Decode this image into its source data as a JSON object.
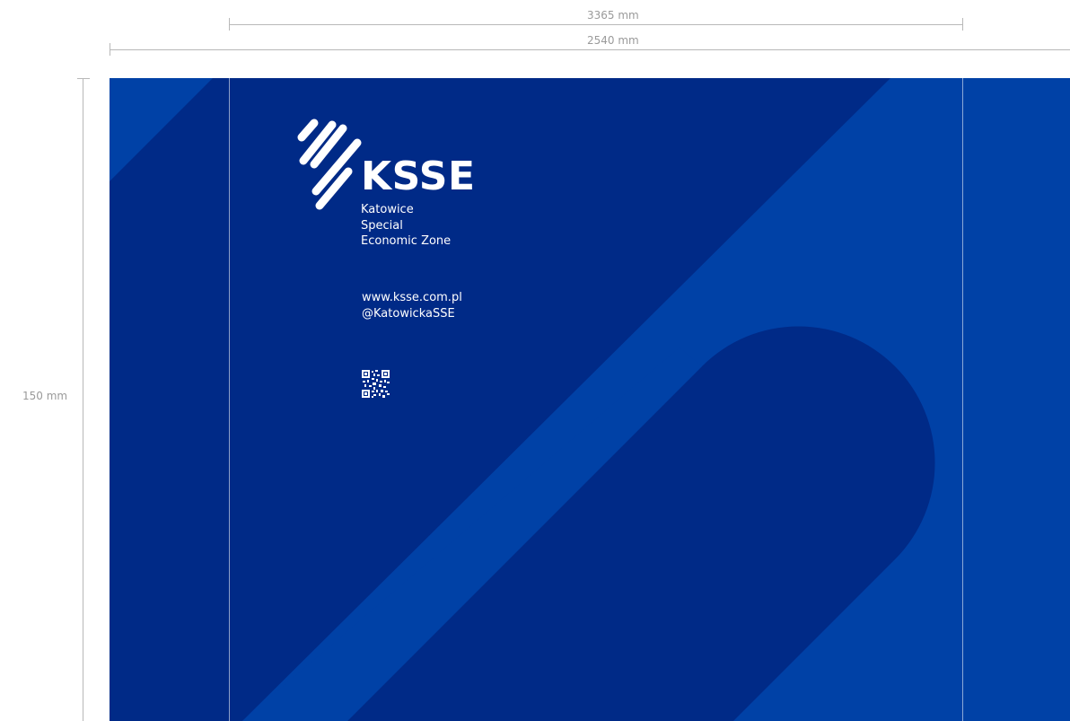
{
  "dimensions": {
    "width_outer": "3365 mm",
    "width_inner": "2540 mm",
    "height": "150 mm"
  },
  "brand": {
    "name": "KSSE",
    "tagline": [
      "Katowice",
      "Special",
      "Economic Zone"
    ],
    "website": "www.ksse.com.pl",
    "handle": "@KatowickaSSE"
  },
  "colors": {
    "navy": "#002a87",
    "royal": "#0041a6"
  },
  "icons": [
    "ksse-stripes-logo-icon",
    "qr-code-icon"
  ]
}
